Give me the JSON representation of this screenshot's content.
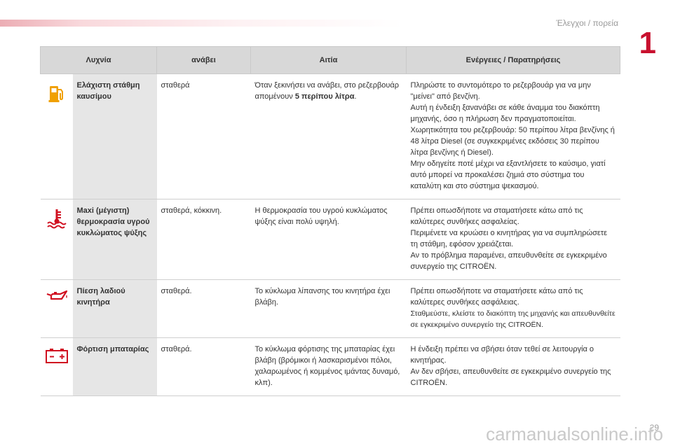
{
  "header": {
    "section_title": "Έλεγχοι / πορεία",
    "chapter_number": "1"
  },
  "table": {
    "columns": [
      "Λυχνία",
      "ανάβει",
      "Αιτία",
      "Ενέργειες / Παρατηρήσεις"
    ],
    "rows": [
      {
        "icon": "fuel-pump-icon",
        "name": "Ελάχιστη στάθμη καυσίμου",
        "state": "σταθερά",
        "cause_pre": "Όταν ξεκινήσει να ανάβει, στο ρεζερβουάρ απομένουν ",
        "cause_bold": "5 περίπου λίτρα",
        "cause_post": ".",
        "actions": [
          "Πληρώστε το συντομότερο το ρεζερβουάρ για να μην \"μείνει\" από βενζίνη.",
          "Αυτή η ένδειξη ξανανάβει σε κάθε άναμμα του διακόπτη μηχανής, όσο η πλήρωση δεν πραγματοποιείται.",
          "Χωρητικότητα του ρεζερβουάρ: 50 περίπου λίτρα βενζίνης ή 48 λίτρα Diesel (σε συγκεκριμένες εκδόσεις 30 περίπου λίτρα βενζίνης ή Diesel).",
          "Μην οδηγείτε ποτέ μέχρι να εξαντλήσετε το καύσιμο, γιατί αυτό μπορεί να προκαλέσει ζημιά στο σύστημα του καταλύτη και στο σύστημα ψεκασμού."
        ]
      },
      {
        "icon": "coolant-temperature-icon",
        "name": "Maxi (μέγιστη) θερμοκρασία υγρού κυκλώματος ψύξης",
        "state": "σταθερά, κόκκινη.",
        "cause": "Η θερμοκρασία του υγρού κυκλώματος ψύξης είναι πολύ υψηλή.",
        "actions": [
          "Πρέπει οπωσδήποτε να σταματήσετε κάτω από τις καλύτερες συνθήκες ασφαλείας.",
          "Περιμένετε να κρυώσει ο κινητήρας για να συμπληρώσετε τη στάθμη, εφόσον χρειάζεται.",
          "Αν το πρόβλημα παραμένει, απευθυνθείτε σε εγκεκριμένο συνεργείο της CITROËN."
        ]
      },
      {
        "icon": "oil-can-icon",
        "name": "Πίεση λαδιού κινητήρα",
        "state": "σταθερά.",
        "cause": "Το κύκλωμα λίπανσης του κινητήρα έχει βλάβη.",
        "actions": [
          "Πρέπει οπωσδήποτε να σταματήσετε κάτω από τις καλύτερες συνθήκες ασφάλειας.",
          "Σταθμεύστε, κλείστε το διακόπτη της μηχανής και απευθυνθείτε σε εγκεκριμένο συνεργείο της CITROËN."
        ]
      },
      {
        "icon": "battery-icon",
        "name": "Φόρτιση μπαταρίας",
        "state": "σταθερά.",
        "cause": "Το κύκλωμα φόρτισης της μπαταρίας έχει βλάβη (βρόμικοι ή λασκαρισμένοι πόλοι, χαλαρωμένος ή κομμένος ιμάντας δυναμό, κλπ).",
        "actions": [
          "Η ένδειξη πρέπει να σβήσει όταν τεθεί σε λειτουργία ο κινητήρας.",
          "Αν δεν σβήσει, απευθυνθείτε σε εγκεκριμένο συνεργείο της CITROËN."
        ]
      }
    ]
  },
  "footer": {
    "page_number": "29",
    "watermark": "carmanualsonline.info"
  },
  "colors": {
    "accent_red": "#c8102e",
    "header_gray": "#d8d8d8",
    "name_cell_gray": "#e6e6e6"
  }
}
